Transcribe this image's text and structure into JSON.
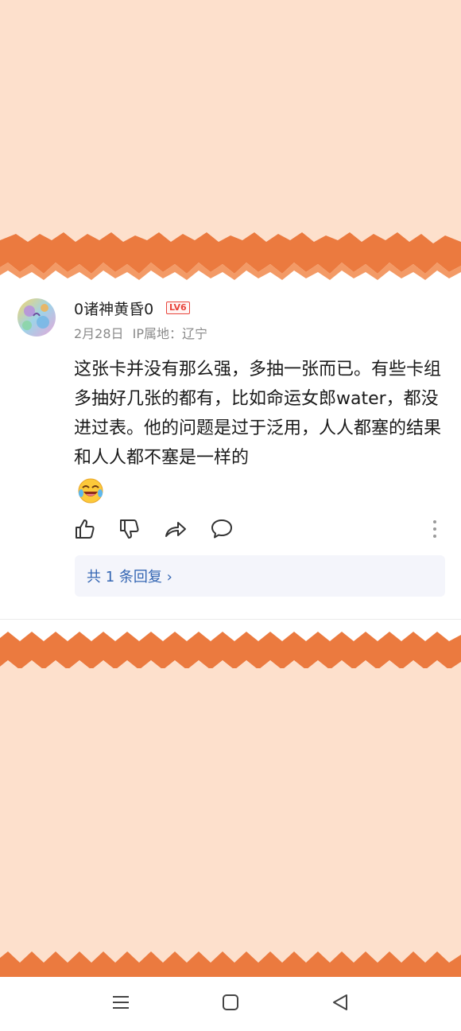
{
  "comment": {
    "username": "0诸神黄昏0",
    "level_badge": "LV6",
    "date": "2月28日",
    "ip_location": "IP属地：辽宁",
    "text": "这张卡并没有那么强，多抽一张而已。有些卡组多抽好几张的都有，比如命运女郎water，都没进过表。他的问题是过于泛用，人人都塞的结果和人人都不塞是一样的",
    "emoji": "laughing-crying-emoji",
    "reply_summary": "共 1 条回复 ›"
  },
  "actions": [
    "like-icon",
    "dislike-icon",
    "share-icon",
    "comment-icon",
    "more-icon"
  ],
  "navigation_bar": [
    "menu-icon",
    "home-icon",
    "back-icon"
  ],
  "colors": {
    "peach_background": "#fde0cc",
    "zigzag_orange": "#eb7a3f",
    "reply_link": "#3466b3",
    "level_badge": "#e8453c"
  }
}
